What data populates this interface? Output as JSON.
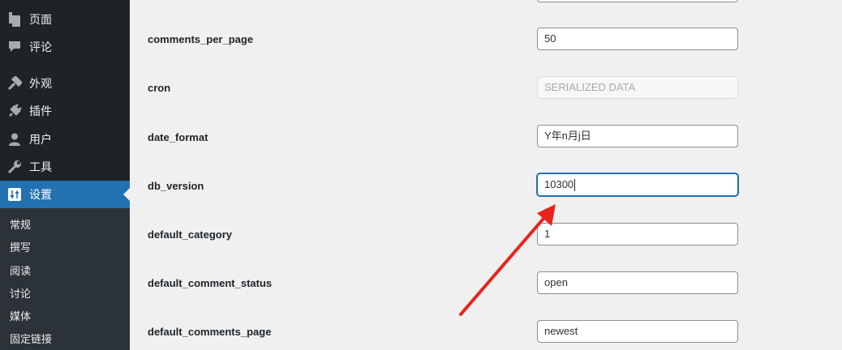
{
  "sidebar": {
    "menu": [
      {
        "label": "页面",
        "icon": "pages-icon"
      },
      {
        "label": "评论",
        "icon": "comments-icon"
      },
      {
        "label": "外观",
        "icon": "appearance-icon"
      },
      {
        "label": "插件",
        "icon": "plugins-icon"
      },
      {
        "label": "用户",
        "icon": "users-icon"
      },
      {
        "label": "工具",
        "icon": "tools-icon"
      },
      {
        "label": "设置",
        "icon": "settings-icon",
        "current": true
      }
    ],
    "submenu": [
      "常规",
      "撰写",
      "阅读",
      "讨论",
      "媒体",
      "固定链接"
    ]
  },
  "options": [
    {
      "name": "comments_per_page",
      "value": "50"
    },
    {
      "name": "cron",
      "value": "SERIALIZED DATA",
      "disabled": true
    },
    {
      "name": "date_format",
      "value": "Y年n月j日"
    },
    {
      "name": "db_version",
      "value": "10300",
      "focused": true
    },
    {
      "name": "default_category",
      "value": "1"
    },
    {
      "name": "default_comment_status",
      "value": "open"
    },
    {
      "name": "default_comments_page",
      "value": "newest"
    }
  ],
  "colors": {
    "sidebar_bg": "#1d2327",
    "submenu_bg": "#2c3338",
    "accent": "#2271b1",
    "annotation_arrow": "#e8241c"
  }
}
